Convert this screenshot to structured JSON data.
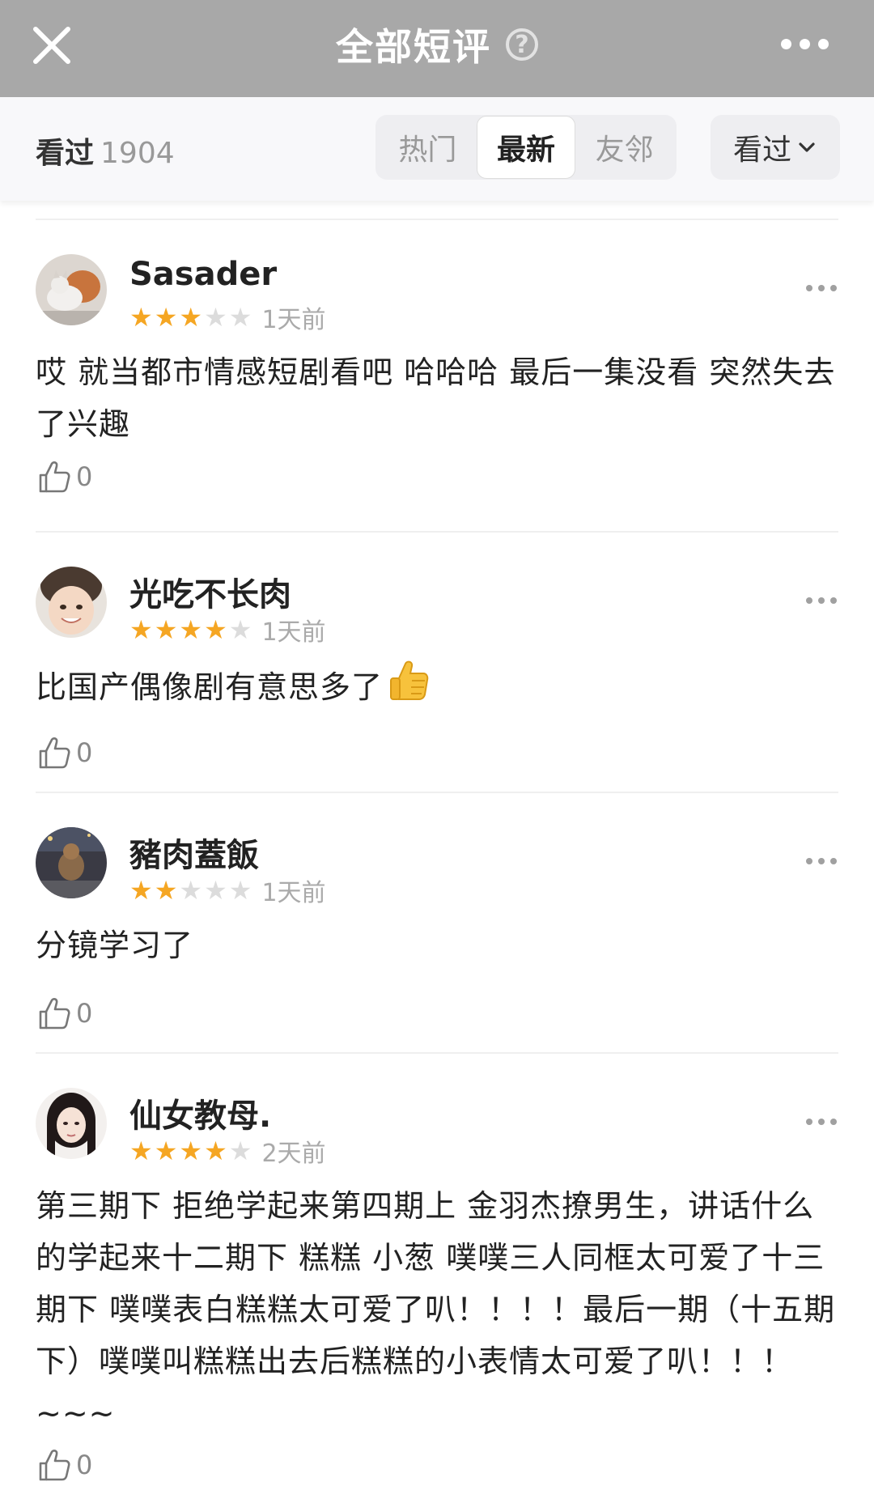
{
  "header": {
    "title": "全部短评",
    "help_icon": "question-circle-icon",
    "close_icon": "close-icon",
    "more_icon": "more-horizontal-icon"
  },
  "filter": {
    "seen_label": "看过",
    "seen_count": "1904",
    "tabs": [
      {
        "label": "热门",
        "active": false
      },
      {
        "label": "最新",
        "active": true
      },
      {
        "label": "友邻",
        "active": false
      }
    ],
    "status_select": "看过"
  },
  "colors": {
    "titlebar": "#a8a8a8",
    "star_active": "#f5a623",
    "star_inactive": "#dcdcdc"
  },
  "reviews": [
    {
      "username": "Sasader",
      "rating": 3,
      "max_rating": 5,
      "time": "1天前",
      "content": "哎 就当都市情感短剧看吧 哈哈哈 最后一集没看 突然失去了兴趣",
      "likes": "0"
    },
    {
      "username": "光吃不长肉",
      "rating": 4,
      "max_rating": 5,
      "time": "1天前",
      "content": "比国产偶像剧有意思多了",
      "content_emoji": "thumbs-up-emoji",
      "likes": "0"
    },
    {
      "username": "豬肉蓋飯",
      "rating": 2,
      "max_rating": 5,
      "time": "1天前",
      "content": "分镜学习了",
      "likes": "0"
    },
    {
      "username": "仙女教母.",
      "rating": 4,
      "max_rating": 5,
      "time": "2天前",
      "content": "第三期下 拒绝学起来第四期上 金羽杰撩男生，讲话什么的学起来十二期下 糕糕 小葱 噗噗三人同框太可爱了十三期下 噗噗表白糕糕太可爱了叭！！！！最后一期（十五期下）噗噗叫糕糕出去后糕糕的小表情太可爱了叭！！！ ~~~",
      "likes": "0"
    }
  ]
}
